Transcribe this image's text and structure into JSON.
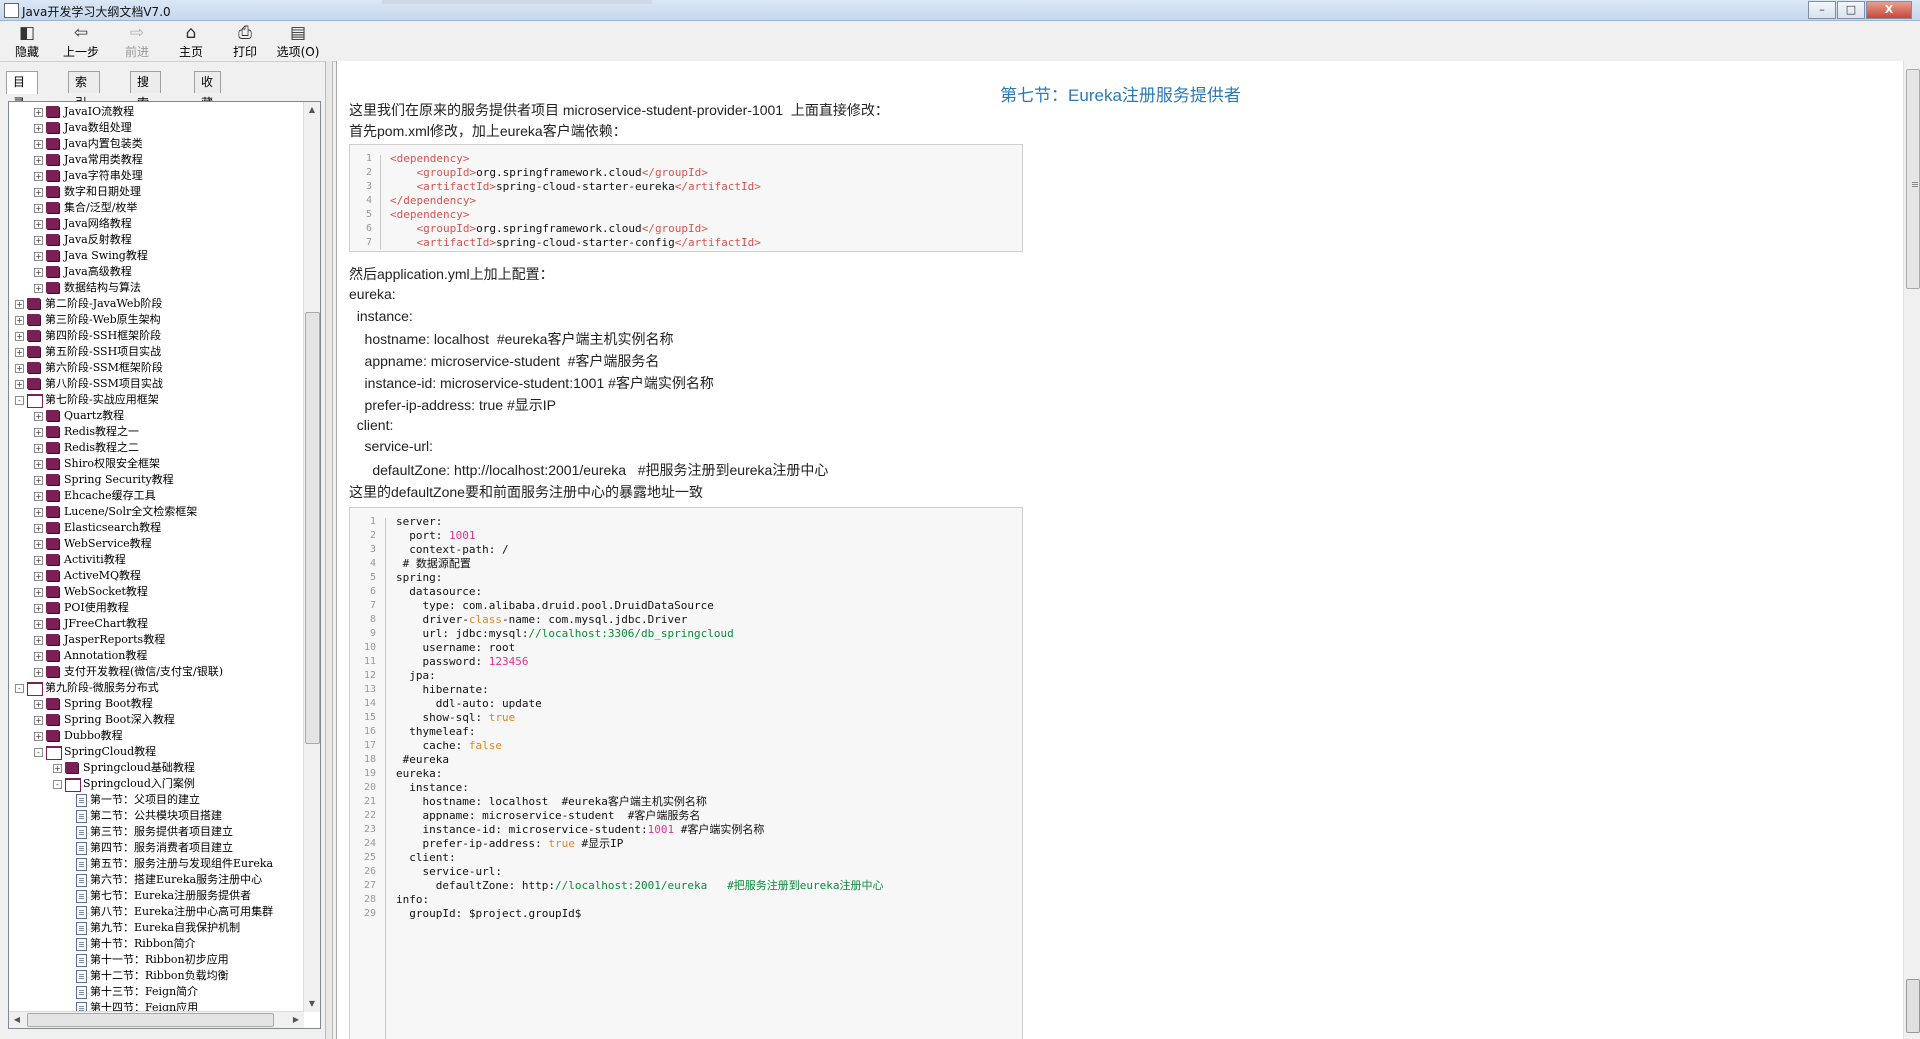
{
  "window": {
    "title": "Java开发学习大纲文档V7.0",
    "controls": [
      "–",
      "□",
      "X"
    ]
  },
  "toolbar": [
    {
      "label": "隐藏",
      "icon": "hide-icon",
      "glyph": "◧",
      "enabled": true
    },
    {
      "label": "上一步",
      "icon": "back-arrow-icon",
      "glyph": "⇦",
      "enabled": true
    },
    {
      "label": "前进",
      "icon": "forward-arrow-icon",
      "glyph": "⇨",
      "enabled": false
    },
    {
      "label": "主页",
      "icon": "home-icon",
      "glyph": "⌂",
      "enabled": true
    },
    {
      "label": "打印",
      "icon": "printer-icon",
      "glyph": "⎙",
      "enabled": true
    },
    {
      "label": "选项(O)",
      "icon": "options-icon",
      "glyph": "▤",
      "enabled": true
    }
  ],
  "tabs": [
    {
      "label": "目录(C)",
      "active": true
    },
    {
      "label": "索引(N)",
      "active": false
    },
    {
      "label": "搜索(S)",
      "active": false
    },
    {
      "label": "收藏夹(I)",
      "active": false
    }
  ],
  "tree": [
    {
      "level": 1,
      "type": "book",
      "expander": "+",
      "label": "JavaIO流教程"
    },
    {
      "level": 1,
      "type": "book",
      "expander": "+",
      "label": "Java数组处理"
    },
    {
      "level": 1,
      "type": "book",
      "expander": "+",
      "label": "Java内置包装类"
    },
    {
      "level": 1,
      "type": "book",
      "expander": "+",
      "label": "Java常用类教程"
    },
    {
      "level": 1,
      "type": "book",
      "expander": "+",
      "label": "Java字符串处理"
    },
    {
      "level": 1,
      "type": "book",
      "expander": "+",
      "label": "数字和日期处理"
    },
    {
      "level": 1,
      "type": "book",
      "expander": "+",
      "label": "集合/泛型/枚举"
    },
    {
      "level": 1,
      "type": "book",
      "expander": "+",
      "label": "Java网络教程"
    },
    {
      "level": 1,
      "type": "book",
      "expander": "+",
      "label": "Java反射教程"
    },
    {
      "level": 1,
      "type": "book",
      "expander": "+",
      "label": "Java Swing教程"
    },
    {
      "level": 1,
      "type": "book",
      "expander": "+",
      "label": "Java高级教程"
    },
    {
      "level": 1,
      "type": "book",
      "expander": "+",
      "label": "数据结构与算法"
    },
    {
      "level": 0,
      "type": "book",
      "expander": "+",
      "label": "第二阶段-JavaWeb阶段"
    },
    {
      "level": 0,
      "type": "book",
      "expander": "+",
      "label": "第三阶段-Web原生架构"
    },
    {
      "level": 0,
      "type": "book",
      "expander": "+",
      "label": "第四阶段-SSH框架阶段"
    },
    {
      "level": 0,
      "type": "book",
      "expander": "+",
      "label": "第五阶段-SSH项目实战"
    },
    {
      "level": 0,
      "type": "book",
      "expander": "+",
      "label": "第六阶段-SSM框架阶段"
    },
    {
      "level": 0,
      "type": "book",
      "expander": "+",
      "label": "第八阶段-SSM项目实战"
    },
    {
      "level": 0,
      "type": "open",
      "expander": "-",
      "label": "第七阶段-实战应用框架"
    },
    {
      "level": 1,
      "type": "book",
      "expander": "+",
      "label": "Quartz教程"
    },
    {
      "level": 1,
      "type": "book",
      "expander": "+",
      "label": "Redis教程之一"
    },
    {
      "level": 1,
      "type": "book",
      "expander": "+",
      "label": "Redis教程之二"
    },
    {
      "level": 1,
      "type": "book",
      "expander": "+",
      "label": "Shiro权限安全框架"
    },
    {
      "level": 1,
      "type": "book",
      "expander": "+",
      "label": "Spring Security教程"
    },
    {
      "level": 1,
      "type": "book",
      "expander": "+",
      "label": "Ehcache缓存工具"
    },
    {
      "level": 1,
      "type": "book",
      "expander": "+",
      "label": "Lucene/Solr全文检索框架"
    },
    {
      "level": 1,
      "type": "book",
      "expander": "+",
      "label": "Elasticsearch教程"
    },
    {
      "level": 1,
      "type": "book",
      "expander": "+",
      "label": "WebService教程"
    },
    {
      "level": 1,
      "type": "book",
      "expander": "+",
      "label": "Activiti教程"
    },
    {
      "level": 1,
      "type": "book",
      "expander": "+",
      "label": "ActiveMQ教程"
    },
    {
      "level": 1,
      "type": "book",
      "expander": "+",
      "label": "WebSocket教程"
    },
    {
      "level": 1,
      "type": "book",
      "expander": "+",
      "label": "POI使用教程"
    },
    {
      "level": 1,
      "type": "book",
      "expander": "+",
      "label": "JFreeChart教程"
    },
    {
      "level": 1,
      "type": "book",
      "expander": "+",
      "label": "JasperReports教程"
    },
    {
      "level": 1,
      "type": "book",
      "expander": "+",
      "label": "Annotation教程"
    },
    {
      "level": 1,
      "type": "book",
      "expander": "+",
      "label": "支付开发教程(微信/支付宝/银联)"
    },
    {
      "level": 0,
      "type": "open",
      "expander": "-",
      "label": "第九阶段-微服务分布式"
    },
    {
      "level": 1,
      "type": "book",
      "expander": "+",
      "label": "Spring Boot教程"
    },
    {
      "level": 1,
      "type": "book",
      "expander": "+",
      "label": "Spring Boot深入教程"
    },
    {
      "level": 1,
      "type": "book",
      "expander": "+",
      "label": "Dubbo教程"
    },
    {
      "level": 1,
      "type": "open",
      "expander": "-",
      "label": "SpringCloud教程"
    },
    {
      "level": 2,
      "type": "book",
      "expander": "+",
      "label": "Springcloud基础教程"
    },
    {
      "level": 2,
      "type": "open",
      "expander": "-",
      "label": "Springcloud入门案例"
    },
    {
      "level": 3,
      "type": "page",
      "expander": "",
      "label": "第一节：父项目的建立"
    },
    {
      "level": 3,
      "type": "page",
      "expander": "",
      "label": "第二节：公共模块项目搭建"
    },
    {
      "level": 3,
      "type": "page",
      "expander": "",
      "label": "第三节：服务提供者项目建立"
    },
    {
      "level": 3,
      "type": "page",
      "expander": "",
      "label": "第四节：服务消费者项目建立"
    },
    {
      "level": 3,
      "type": "page",
      "expander": "",
      "label": "第五节：服务注册与发现组件Eureka"
    },
    {
      "level": 3,
      "type": "page",
      "expander": "",
      "label": "第六节：搭建Eureka服务注册中心"
    },
    {
      "level": 3,
      "type": "page",
      "expander": "",
      "label": "第七节：Eureka注册服务提供者"
    },
    {
      "level": 3,
      "type": "page",
      "expander": "",
      "label": "第八节：Eureka注册中心高可用集群"
    },
    {
      "level": 3,
      "type": "page",
      "expander": "",
      "label": "第九节：Eureka自我保护机制"
    },
    {
      "level": 3,
      "type": "page",
      "expander": "",
      "label": "第十节：Ribbon简介"
    },
    {
      "level": 3,
      "type": "page",
      "expander": "",
      "label": "第十一节：Ribbon初步应用"
    },
    {
      "level": 3,
      "type": "page",
      "expander": "",
      "label": "第十二节：Ribbon负载均衡"
    },
    {
      "level": 3,
      "type": "page",
      "expander": "",
      "label": "第十三节：Feign简介"
    },
    {
      "level": 3,
      "type": "page",
      "expander": "",
      "label": "第十四节：Feign应用"
    }
  ],
  "article": {
    "heading": "第七节：Eureka注册服务提供者",
    "intro1": "这里我们在原来的服务提供者项目 microservice-student-provider-1001  上面直接修改：",
    "intro2": "首先pom.xml修改，加上eureka客户端依赖：",
    "code1": [
      [
        {
          "t": "<",
          "c": "tag"
        },
        {
          "t": "dependency",
          "c": "tag"
        },
        {
          "t": ">",
          "c": "tag"
        }
      ],
      [
        {
          "t": "    <",
          "c": "tag"
        },
        {
          "t": "groupId",
          "c": "tag"
        },
        {
          "t": ">",
          "c": "tag"
        },
        {
          "t": "org.springframework.cloud",
          "c": "k"
        },
        {
          "t": "</",
          "c": "tag"
        },
        {
          "t": "groupId",
          "c": "tag"
        },
        {
          "t": ">",
          "c": "tag"
        }
      ],
      [
        {
          "t": "    <",
          "c": "tag"
        },
        {
          "t": "artifactId",
          "c": "tag"
        },
        {
          "t": ">",
          "c": "tag"
        },
        {
          "t": "spring-cloud-starter-eureka",
          "c": "k"
        },
        {
          "t": "</",
          "c": "tag"
        },
        {
          "t": "artifactId",
          "c": "tag"
        },
        {
          "t": ">",
          "c": "tag"
        }
      ],
      [
        {
          "t": "</",
          "c": "tag"
        },
        {
          "t": "dependency",
          "c": "tag"
        },
        {
          "t": ">",
          "c": "tag"
        }
      ],
      [
        {
          "t": "<",
          "c": "tag"
        },
        {
          "t": "dependency",
          "c": "tag"
        },
        {
          "t": ">",
          "c": "tag"
        }
      ],
      [
        {
          "t": "    <",
          "c": "tag"
        },
        {
          "t": "groupId",
          "c": "tag"
        },
        {
          "t": ">",
          "c": "tag"
        },
        {
          "t": "org.springframework.cloud",
          "c": "k"
        },
        {
          "t": "</",
          "c": "tag"
        },
        {
          "t": "groupId",
          "c": "tag"
        },
        {
          "t": ">",
          "c": "tag"
        }
      ],
      [
        {
          "t": "    <",
          "c": "tag"
        },
        {
          "t": "artifactId",
          "c": "tag"
        },
        {
          "t": ">",
          "c": "tag"
        },
        {
          "t": "spring-cloud-starter-config",
          "c": "k"
        },
        {
          "t": "</",
          "c": "tag"
        },
        {
          "t": "artifactId",
          "c": "tag"
        },
        {
          "t": ">",
          "c": "tag"
        }
      ],
      [
        {
          "t": "</",
          "c": "tag"
        },
        {
          "t": "dependency",
          "c": "tag"
        },
        {
          "t": ">",
          "c": "tag"
        }
      ]
    ],
    "mid": [
      "然后application.yml上加上配置：",
      "eureka:",
      "  instance:",
      "    hostname: localhost  #eureka客户端主机实例名称",
      "    appname: microservice-student  #客户端服务名",
      "    instance-id: microservice-student:1001 #客户端实例名称",
      "    prefer-ip-address: true #显示IP",
      "  client:",
      "    service-url:",
      "      defaultZone: http://localhost:2001/eureka   #把服务注册到eureka注册中心",
      "这里的defaultZone要和前面服务注册中心的暴露地址一致"
    ],
    "code2": [
      [
        {
          "t": "server:",
          "c": "k"
        }
      ],
      [
        {
          "t": "  port: ",
          "c": "k"
        },
        {
          "t": "1001",
          "c": "num"
        }
      ],
      [
        {
          "t": "  context-path: /",
          "c": "k"
        }
      ],
      [
        {
          "t": " # 数据源配置",
          "c": "k"
        }
      ],
      [
        {
          "t": "spring:",
          "c": "k"
        }
      ],
      [
        {
          "t": "  datasource:",
          "c": "k"
        }
      ],
      [
        {
          "t": "    type: com.alibaba.druid.pool.DruidDataSource",
          "c": "k"
        }
      ],
      [
        {
          "t": "    driver-",
          "c": "k"
        },
        {
          "t": "class",
          "c": "kw"
        },
        {
          "t": "-name: com.mysql.jdbc.Driver",
          "c": "k"
        }
      ],
      [
        {
          "t": "    url: jdbc:mysql:",
          "c": "k"
        },
        {
          "t": "//localhost:3306/db_springcloud",
          "c": "str"
        }
      ],
      [
        {
          "t": "    username: root",
          "c": "k"
        }
      ],
      [
        {
          "t": "    password: ",
          "c": "k"
        },
        {
          "t": "123456",
          "c": "num"
        }
      ],
      [
        {
          "t": "  jpa:",
          "c": "k"
        }
      ],
      [
        {
          "t": "    hibernate:",
          "c": "k"
        }
      ],
      [
        {
          "t": "      ddl-auto: update",
          "c": "k"
        }
      ],
      [
        {
          "t": "    show-sql: ",
          "c": "k"
        },
        {
          "t": "true",
          "c": "kw"
        }
      ],
      [
        {
          "t": "  thymeleaf:",
          "c": "k"
        }
      ],
      [
        {
          "t": "    cache: ",
          "c": "k"
        },
        {
          "t": "false",
          "c": "kw"
        }
      ],
      [
        {
          "t": " #eureka",
          "c": "k"
        }
      ],
      [
        {
          "t": "eureka:",
          "c": "k"
        }
      ],
      [
        {
          "t": "  instance:",
          "c": "k"
        }
      ],
      [
        {
          "t": "    hostname: localhost  #eureka客户端主机实例名称",
          "c": "k"
        }
      ],
      [
        {
          "t": "    appname: microservice-student  #客户端服务名",
          "c": "k"
        }
      ],
      [
        {
          "t": "    instance-id: microservice-student:",
          "c": "k"
        },
        {
          "t": "1001",
          "c": "num"
        },
        {
          "t": " #客户端实例名称",
          "c": "k"
        }
      ],
      [
        {
          "t": "    prefer-ip-address: ",
          "c": "k"
        },
        {
          "t": "true",
          "c": "kw"
        },
        {
          "t": " #显示IP",
          "c": "k"
        }
      ],
      [
        {
          "t": "  client:",
          "c": "k"
        }
      ],
      [
        {
          "t": "    service-url:",
          "c": "k"
        }
      ],
      [
        {
          "t": "      defaultZone: http:",
          "c": "k"
        },
        {
          "t": "//localhost:2001/eureka   #把服务注册到eureka注册中心",
          "c": "str"
        }
      ],
      [
        {
          "t": "info:",
          "c": "k"
        }
      ],
      [
        {
          "t": "  groupId: $project.groupId$",
          "c": "k"
        }
      ]
    ]
  }
}
